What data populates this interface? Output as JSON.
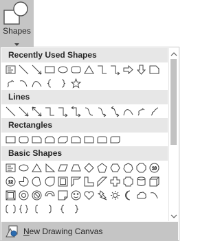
{
  "ribbon": {
    "button_label": "Shapes",
    "icon": "shapes-icon"
  },
  "gallery": {
    "sections": [
      {
        "title": "Recently Used Shapes",
        "rows": [
          [
            "text-box",
            "line",
            "arrow",
            "rectangle",
            "oval",
            "rounded-rectangle",
            "triangle",
            "elbow-connector",
            "elbow-arrow-connector",
            "right-arrow",
            "down-arrow",
            "snip-corner"
          ],
          [
            "freeform",
            "arc",
            "curve",
            "left-brace",
            "right-brace",
            "star"
          ]
        ]
      },
      {
        "title": "Lines",
        "rows": [
          [
            "line",
            "arrow",
            "double-arrow",
            "elbow-connector",
            "elbow-arrow-connector",
            "elbow-double-arrow",
            "curved-connector",
            "curved-arrow-connector",
            "curved-double-arrow",
            "curve",
            "freeform",
            "scribble"
          ]
        ]
      },
      {
        "title": "Rectangles",
        "rows": [
          [
            "rectangle",
            "rounded-rectangle",
            "snip-single-corner",
            "snip-same-side",
            "snip-diagonal",
            "snip-round-corner",
            "round-single-corner",
            "round-same-side",
            "round-diagonal"
          ]
        ]
      },
      {
        "title": "Basic Shapes",
        "rows": [
          [
            "text-box",
            "oval",
            "triangle",
            "right-triangle",
            "parallelogram",
            "trapezoid",
            "diamond",
            "pentagon",
            "hexagon",
            "heptagon",
            "octagon",
            "decagon"
          ],
          [
            "dodecagon",
            "pie",
            "chord",
            "teardrop",
            "frame",
            "half-frame",
            "l-shape",
            "diagonal-stripe",
            "cross",
            "plaque",
            "can",
            "cube"
          ],
          [
            "bevel",
            "donut",
            "no-symbol",
            "block-arc",
            "folded-corner",
            "smiley-face",
            "heart",
            "lightning-bolt",
            "sun",
            "moon",
            "cloud",
            "arc"
          ],
          [
            "double-bracket",
            "double-brace",
            "left-bracket",
            "right-bracket",
            "left-brace",
            "right-brace"
          ]
        ]
      }
    ],
    "command": {
      "label_underlined": "N",
      "label_rest": "ew Drawing Canvas",
      "icon": "drawing-canvas-icon"
    }
  }
}
